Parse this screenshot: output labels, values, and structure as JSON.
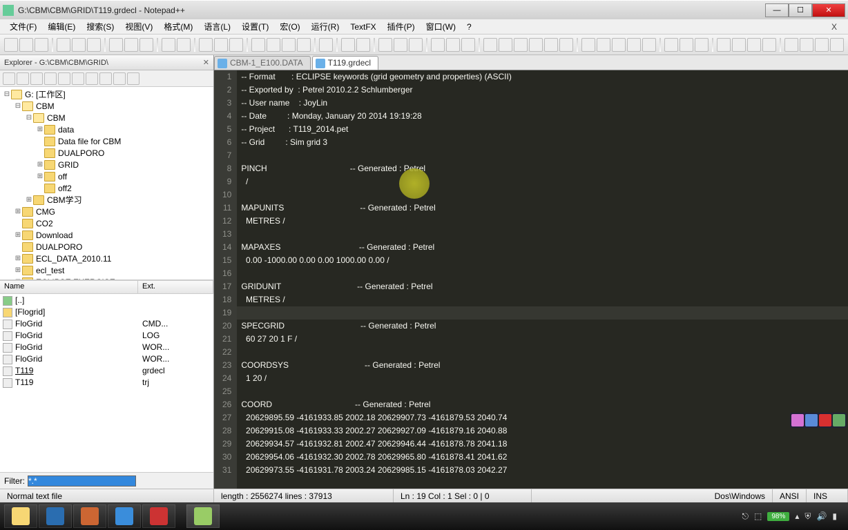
{
  "window": {
    "title": "G:\\CBM\\CBM\\GRID\\T119.grdecl - Notepad++"
  },
  "menu": {
    "items": [
      "文件(F)",
      "编辑(E)",
      "搜索(S)",
      "视图(V)",
      "格式(M)",
      "语言(L)",
      "设置(T)",
      "宏(O)",
      "运行(R)",
      "TextFX",
      "插件(P)",
      "窗口(W)",
      "?"
    ],
    "close": "X"
  },
  "explorer": {
    "title": "Explorer - G:\\CBM\\CBM\\GRID\\",
    "root": "G: [工作区]",
    "tree": [
      {
        "depth": 0,
        "twist": "⊟",
        "label": "G: [工作区]",
        "open": true
      },
      {
        "depth": 1,
        "twist": "⊟",
        "label": "CBM",
        "open": true
      },
      {
        "depth": 2,
        "twist": "⊟",
        "label": "CBM",
        "open": true
      },
      {
        "depth": 3,
        "twist": "⊞",
        "label": "data"
      },
      {
        "depth": 3,
        "twist": "",
        "label": "Data file for CBM"
      },
      {
        "depth": 3,
        "twist": "",
        "label": "DUALPORO"
      },
      {
        "depth": 3,
        "twist": "⊞",
        "label": "GRID"
      },
      {
        "depth": 3,
        "twist": "⊞",
        "label": "off"
      },
      {
        "depth": 3,
        "twist": "",
        "label": "off2"
      },
      {
        "depth": 2,
        "twist": "⊞",
        "label": "CBM学习"
      },
      {
        "depth": 1,
        "twist": "⊞",
        "label": "CMG"
      },
      {
        "depth": 1,
        "twist": "",
        "label": "CO2"
      },
      {
        "depth": 1,
        "twist": "⊞",
        "label": "Download"
      },
      {
        "depth": 1,
        "twist": "",
        "label": "DUALPORO"
      },
      {
        "depth": 1,
        "twist": "⊞",
        "label": "ECL_DATA_2010.11"
      },
      {
        "depth": 1,
        "twist": "⊞",
        "label": "ecl_test"
      },
      {
        "depth": 1,
        "twist": "⊞",
        "label": "ECLIPSE EXERCISE"
      }
    ],
    "columns": {
      "name": "Name",
      "ext": "Ext."
    },
    "files": [
      {
        "name": "[..]",
        "ext": "",
        "icon": "up"
      },
      {
        "name": "[Flogrid]",
        "ext": "",
        "icon": "folder"
      },
      {
        "name": "FloGrid",
        "ext": "CMD..."
      },
      {
        "name": "FloGrid",
        "ext": "LOG"
      },
      {
        "name": "FloGrid",
        "ext": "WOR..."
      },
      {
        "name": "FloGrid",
        "ext": "WOR..."
      },
      {
        "name": "T119",
        "ext": "grdecl",
        "sel": true,
        "under": true
      },
      {
        "name": "T119",
        "ext": "trj"
      }
    ],
    "filter_label": "Filter:"
  },
  "tabs": [
    {
      "label": "CBM-1_E100.DATA",
      "active": false
    },
    {
      "label": "T119.grdecl",
      "active": true
    }
  ],
  "code": {
    "lines": [
      "-- Format       : ECLIPSE keywords (grid geometry and properties) (ASCII)",
      "-- Exported by  : Petrel 2010.2.2 Schlumberger",
      "-- User name    : JoyLin",
      "-- Date         : Monday, January 20 2014 19:19:28",
      "-- Project      : T119_2014.pet",
      "-- Grid         : Sim grid 3",
      "",
      "PINCH                                    -- Generated : Petrel",
      "  /",
      "",
      "MAPUNITS                                 -- Generated : Petrel",
      "  METRES /",
      "",
      "MAPAXES                                  -- Generated : Petrel",
      "  0.00 -1000.00 0.00 0.00 1000.00 0.00 /",
      "",
      "GRIDUNIT                                 -- Generated : Petrel",
      "  METRES /",
      "",
      "SPECGRID                                 -- Generated : Petrel",
      "  60 27 20 1 F /",
      "",
      "COORDSYS                                 -- Generated : Petrel",
      "  1 20 /",
      "",
      "COORD                                    -- Generated : Petrel",
      "  20629895.59 -4161933.85 2002.18 20629907.73 -4161879.53 2040.74",
      "  20629915.08 -4161933.33 2002.27 20629927.09 -4161879.16 2040.88",
      "  20629934.57 -4161932.81 2002.47 20629946.44 -4161878.78 2041.18",
      "  20629954.06 -4161932.30 2002.78 20629965.80 -4161878.41 2041.62",
      "  20629973.55 -4161931.78 2003.24 20629985.15 -4161878.03 2042.27"
    ],
    "first_line_no": 1,
    "highlight_line": 19
  },
  "status": {
    "left": "Normal text file",
    "length": "length : 2556274    lines : 37913",
    "pos": "Ln : 19   Col : 1   Sel : 0 | 0",
    "eol": "Dos\\Windows",
    "enc": "ANSI",
    "mode": "INS"
  },
  "tray": {
    "battery": "98%"
  }
}
